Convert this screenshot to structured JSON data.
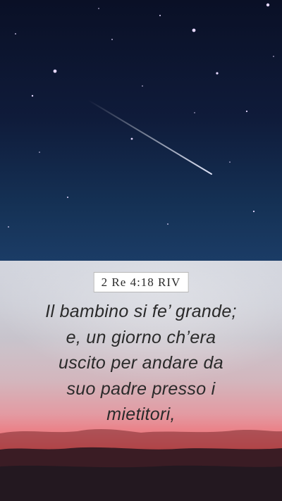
{
  "reference": "2 Re 4:18 RIV",
  "verse_lines": [
    "Il bambino si fe’ grande;",
    "e, un giorno ch’era",
    "uscito per andare da",
    "suo padre presso i",
    "mietitori,"
  ],
  "colors": {
    "sky_top": "#0a1026",
    "sky_bottom": "#1b3c66",
    "sunset_red": "#f25d5b",
    "text": "#2a2a2a"
  }
}
